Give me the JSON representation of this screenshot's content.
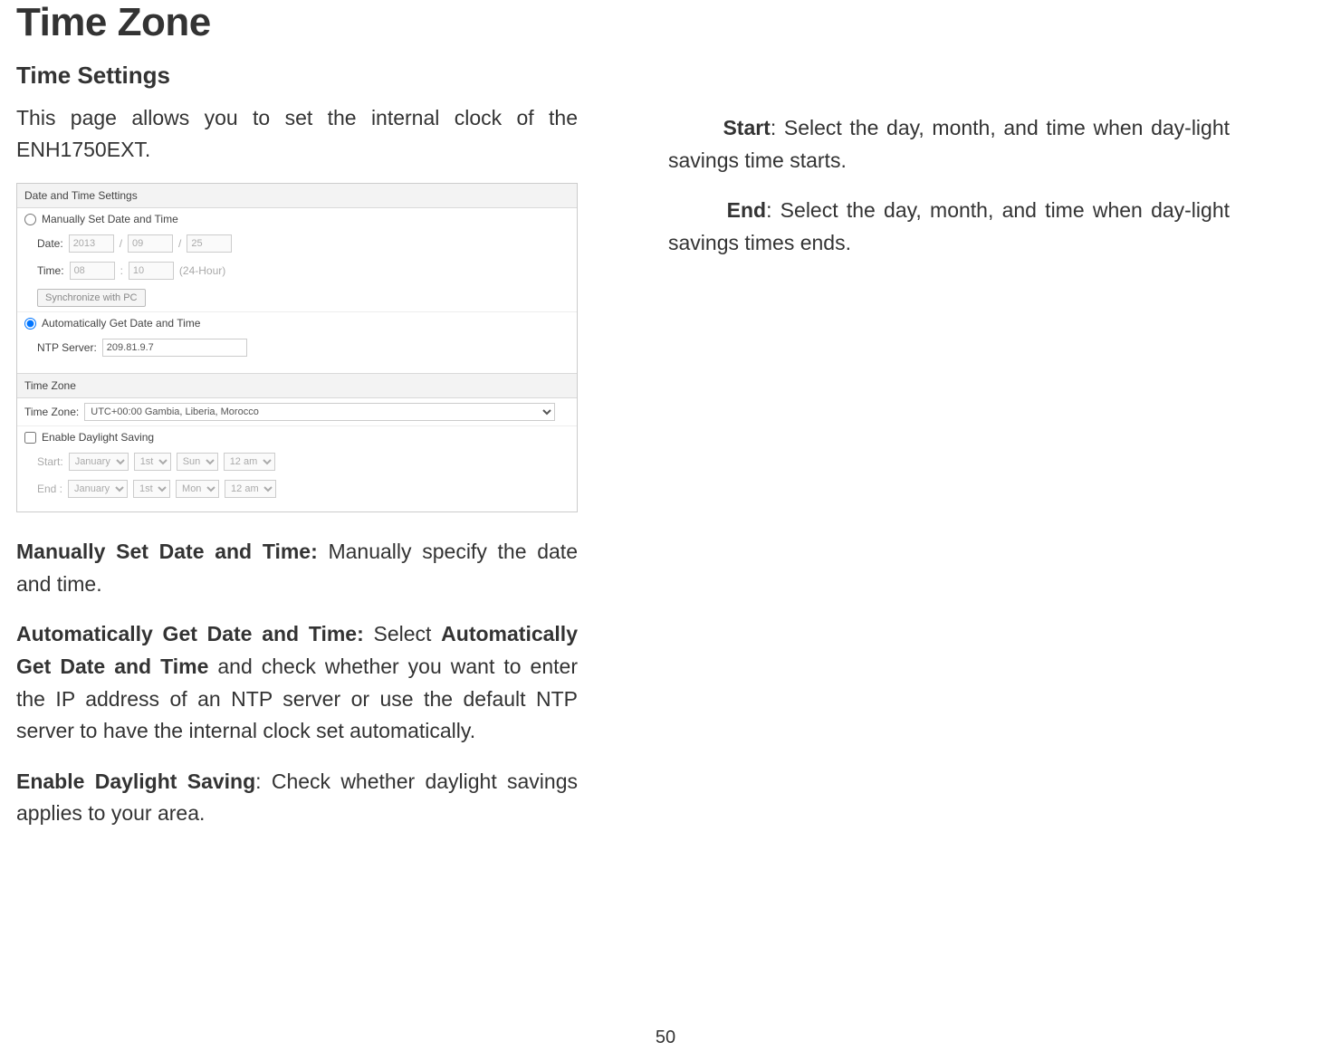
{
  "page_number": "50",
  "title": "Time Zone",
  "subtitle": "Time Settings",
  "intro": "This page allows you to set the internal clock of the ENH1750EXT.",
  "panel": {
    "section1_header": "Date and Time Settings",
    "manual_label": "Manually Set Date and Time",
    "date_label": "Date:",
    "date_year": "2013",
    "date_month": "09",
    "date_day": "25",
    "slash": "/",
    "time_label": "Time:",
    "time_hour": "08",
    "colon": ":",
    "time_min": "10",
    "time_format": "(24-Hour)",
    "sync_btn": "Synchronize with PC",
    "auto_label": "Automatically Get Date and Time",
    "ntp_label": "NTP Server:",
    "ntp_value": "209.81.9.7",
    "section2_header": "Time Zone",
    "tz_label": "Time Zone:",
    "tz_value": "UTC+00:00 Gambia, Liberia, Morocco",
    "dst_label": "Enable Daylight Saving",
    "start_label": "Start:",
    "end_label": "End :",
    "months": {
      "jan": "January"
    },
    "days": {
      "first": "1st"
    },
    "weekdays": {
      "sun": "Sun",
      "mon": "Mon"
    },
    "hours": {
      "twelve": "12 am"
    }
  },
  "paragraphs": {
    "p1_label": "Manually Set Date and Time:",
    "p1_text": " Manually specify the date and time.",
    "p2_label": "Automatically Get Date and Time:",
    "p2_text1": " Select ",
    "p2_bold": "Automatically Get Date and Time",
    "p2_text2": " and check whether you want to enter the IP address of an NTP server or use the default NTP server to have the internal clock set automatically.",
    "p3_label": "Enable Daylight Saving",
    "p3_text": ": Check whether daylight savings applies to your area.",
    "start_label": "Start",
    "start_text": ": Select the day, month, and time when day-light savings time starts.",
    "end_label": "End",
    "end_text": ": Select the day, month, and time when day-light savings times ends."
  }
}
